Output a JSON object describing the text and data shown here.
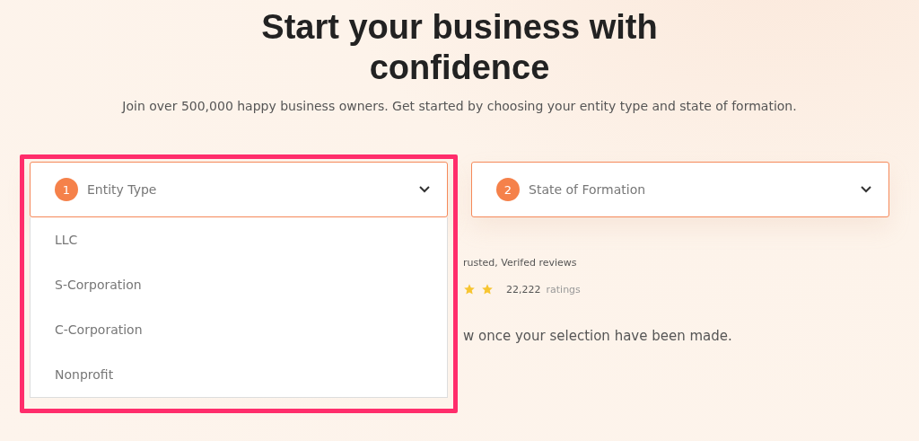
{
  "heading": "Start your business with confidence",
  "subtitle": "Join over 500,000 happy business owners. Get started by choosing your entity type and state of formation.",
  "selects": [
    {
      "step": "1",
      "label": "Entity Type",
      "expanded": true,
      "options": [
        "LLC",
        "S-Corporation",
        "C-Corporation",
        "Nonprofit"
      ]
    },
    {
      "step": "2",
      "label": "State of Formation",
      "expanded": false
    }
  ],
  "reviews": {
    "caption": "rusted, Verifed reviews",
    "count": "22,222",
    "count_label": "ratings"
  },
  "note": "w once your selection have been made.",
  "highlight": true
}
